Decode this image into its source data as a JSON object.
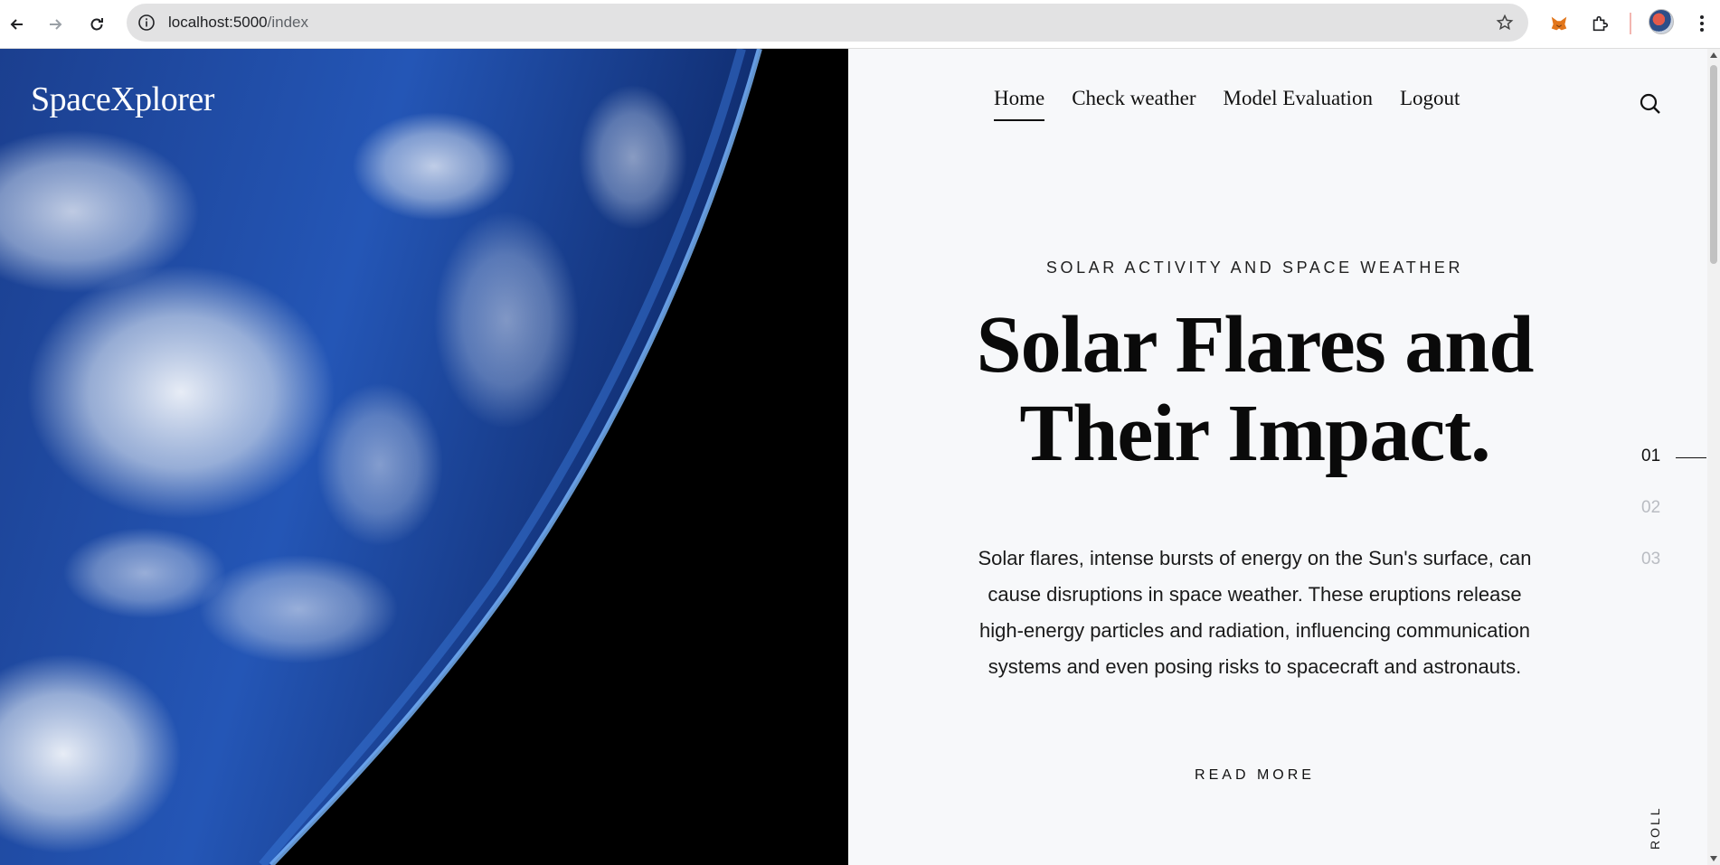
{
  "browser": {
    "url_host": "localhost:5000",
    "url_path": "/index",
    "icons": [
      "back-icon",
      "forward-icon",
      "reload-icon",
      "site-info-icon",
      "bookmark-star-icon",
      "metamask-fox-icon",
      "extensions-puzzle-icon",
      "profile-avatar",
      "more-menu-icon"
    ]
  },
  "site": {
    "brand": "SpaceXplorer"
  },
  "nav": {
    "items": [
      {
        "label": "Home",
        "active": true
      },
      {
        "label": "Check weather",
        "active": false
      },
      {
        "label": "Model Evaluation",
        "active": false
      },
      {
        "label": "Logout",
        "active": false
      }
    ],
    "search_icon": "search-icon"
  },
  "hero": {
    "kicker": "SOLAR ACTIVITY AND SPACE WEATHER",
    "headline": "Solar Flares and Their Impact.",
    "body": "Solar flares, intense bursts of energy on the Sun's surface, can cause disruptions in space weather. These eruptions release high-energy particles and radiation, influencing communication systems and even posing risks to spacecraft and astronauts.",
    "cta": "READ MORE"
  },
  "slides": {
    "items": [
      "01",
      "02",
      "03"
    ],
    "active_index": 0,
    "scroll_label": "ROLL"
  },
  "colors": {
    "panel_bg": "#f7f8fa",
    "text": "#111111",
    "inactive_slide": "#b9bcc2"
  }
}
